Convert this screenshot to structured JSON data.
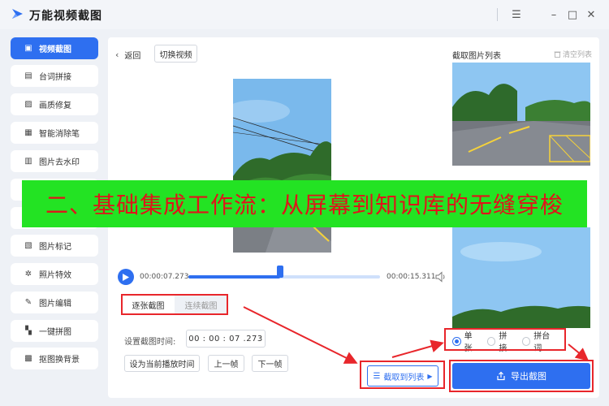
{
  "app": {
    "title": "万能视频截图"
  },
  "window_controls": {
    "menu": "☰",
    "minimize": "–",
    "maximize": "□",
    "close": "✕"
  },
  "sidebar": {
    "items": [
      {
        "label": "视频截图",
        "icon": "video-icon",
        "active": true
      },
      {
        "label": "台词拼接",
        "icon": "subtitle-icon",
        "active": false
      },
      {
        "label": "画质修复",
        "icon": "image-icon",
        "active": false
      },
      {
        "label": "智能消除笔",
        "icon": "eraser-icon",
        "active": false
      },
      {
        "label": "图片去水印",
        "icon": "watermark-icon",
        "active": false
      },
      {
        "label": "",
        "icon": "",
        "active": false
      },
      {
        "label": "",
        "icon": "",
        "active": false
      },
      {
        "label": "图片标记",
        "icon": "mark-icon",
        "active": false
      },
      {
        "label": "照片特效",
        "icon": "effect-icon",
        "active": false
      },
      {
        "label": "图片编辑",
        "icon": "edit-icon",
        "active": false
      },
      {
        "label": "一键拼图",
        "icon": "collage-icon",
        "active": false
      },
      {
        "label": "抠图换背景",
        "icon": "cutout-icon",
        "active": false
      }
    ]
  },
  "toolbar": {
    "back_label": "返回",
    "switch_label": "切换视频"
  },
  "player": {
    "current_time": "00:00:07.273",
    "total_time": "00:00:15.311",
    "progress": 0.48
  },
  "mode_tabs": {
    "single": "逐张截图",
    "continuous": "连续截图"
  },
  "capture_time": {
    "label": "设置截图时间:",
    "value": "00 : 00 : 07 .273"
  },
  "buttons": {
    "set_current": "设为当前播放时间",
    "prev_frame": "上一帧",
    "next_frame": "下一帧",
    "capture_to_list": "截取到列表",
    "export": "导出截图"
  },
  "list_panel": {
    "title": "截取图片列表",
    "clear_label": "清空列表"
  },
  "export_modes": [
    {
      "label": "单张",
      "selected": true
    },
    {
      "label": "拼接",
      "selected": false
    },
    {
      "label": "拼台词",
      "selected": false
    }
  ],
  "overlay": {
    "text": "二、基础集成工作流：从屏幕到知识库的无缝穿梭"
  },
  "colors": {
    "accent": "#2e6ff0",
    "annotation_red": "#e8262b",
    "banner_green": "#23e323",
    "banner_text": "#e0141a"
  }
}
